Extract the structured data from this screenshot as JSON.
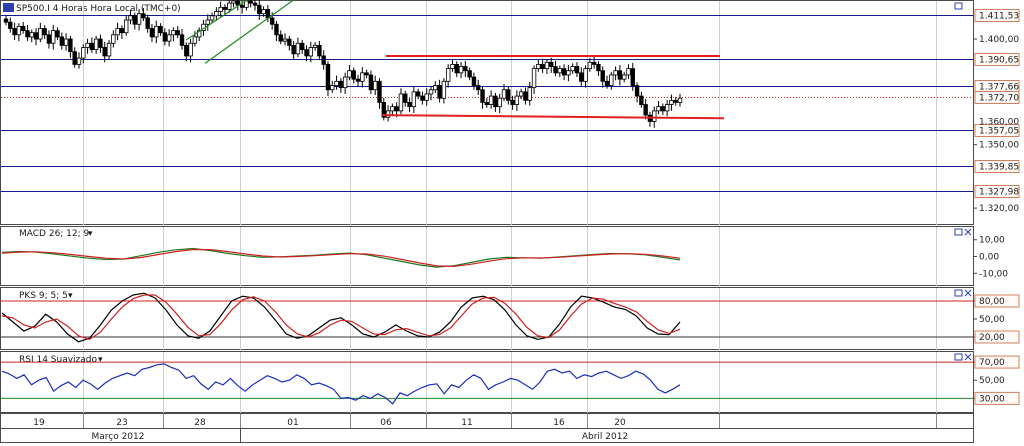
{
  "colors": {
    "background": "#ffffff",
    "pane_border": "#4a4a4a",
    "gridline": "#cfcfcf",
    "horizontal_level": "#1a1a8c",
    "red_level": "#e02020",
    "trend_line": "#1f8a1f",
    "candle": "#000000",
    "macd_line": "#1f7a1f",
    "signal_line": "#d02020",
    "stoch_k": "#000000",
    "stoch_d": "#d02020",
    "rsi_line": "#1a2fbf",
    "rsi_upper": "#d02020",
    "rsi_lower": "#1f8a1f",
    "badge_border": "#d08060",
    "badge_fill": "#fffaf5"
  },
  "header": {
    "symbol_icon": "instrument-icon",
    "title": "SP500.I 4 Horas Hora Local (TMC+0)"
  },
  "chart_data": [
    {
      "type": "candlestick",
      "pane": "price",
      "title": "SP500.I 4 Horas Hora Local (TMC+0)",
      "ylim": [
        1312,
        1418
      ],
      "y_ticks": [
        1400.0,
        1350.0,
        1320.0
      ],
      "y_tick_labels": [
        "1.400,00",
        "1.350,00",
        "1.320,00"
      ],
      "level_lines": [
        1411.53,
        1390.65,
        1377.66,
        1357.05,
        1339.85,
        1327.98
      ],
      "level_labels": [
        "1.411,53",
        "1.390,65",
        "1.377,66",
        "1.357,05",
        "1.339,85",
        "1.327,98"
      ],
      "last_price": 1372.7,
      "last_price_label": "1.372,70",
      "hidden_tick_label": "1.360,00",
      "red_resistance": {
        "from": 1392.0,
        "to": 1392.0
      },
      "red_support": {
        "from": 1364.0,
        "to": 1362.5
      },
      "green_trend": {
        "from": 1388.5,
        "to": 1419.0
      },
      "close": [
        1408,
        1405,
        1402,
        1406,
        1404,
        1401,
        1403,
        1400,
        1405,
        1402,
        1398,
        1404,
        1401,
        1397,
        1400,
        1394,
        1388,
        1391,
        1396,
        1398,
        1395,
        1400,
        1396,
        1392,
        1398,
        1402,
        1405,
        1403,
        1409,
        1411,
        1407,
        1412,
        1410,
        1405,
        1401,
        1406,
        1403,
        1399,
        1402,
        1404,
        1402,
        1397,
        1392,
        1398,
        1401,
        1404,
        1407,
        1409,
        1411,
        1413,
        1415,
        1414,
        1417,
        1418,
        1416,
        1415,
        1418,
        1417,
        1416,
        1412,
        1414,
        1410,
        1407,
        1402,
        1399,
        1400,
        1397,
        1393,
        1398,
        1395,
        1392,
        1396,
        1397,
        1392,
        1388,
        1376,
        1378,
        1380,
        1377,
        1382,
        1385,
        1381,
        1380,
        1384,
        1383,
        1376,
        1380,
        1370,
        1363,
        1366,
        1368,
        1366,
        1374,
        1370,
        1368,
        1375,
        1373,
        1371,
        1374,
        1376,
        1378,
        1372,
        1380,
        1386,
        1388,
        1384,
        1387,
        1385,
        1382,
        1378,
        1376,
        1370,
        1369,
        1373,
        1368,
        1372,
        1376,
        1371,
        1369,
        1373,
        1375,
        1371,
        1377,
        1386,
        1388,
        1386,
        1389,
        1387,
        1384,
        1386,
        1383,
        1385,
        1387,
        1384,
        1380,
        1386,
        1389,
        1388,
        1385,
        1380,
        1378,
        1383,
        1385,
        1381,
        1383,
        1386,
        1378,
        1373,
        1369,
        1364,
        1361,
        1366,
        1368,
        1366,
        1369,
        1371,
        1370,
        1372
      ],
      "x_tick_labels": [
        "19",
        "23",
        "28",
        "01",
        "06",
        "11",
        "16",
        "20"
      ],
      "month_labels": [
        "Março 2012",
        "Abril 2012"
      ]
    },
    {
      "type": "line",
      "pane": "macd",
      "title": "MACD 26; 12; 9",
      "ylim": [
        -17,
        17
      ],
      "y_ticks": [
        10,
        0,
        -10
      ],
      "y_tick_labels": [
        "10,00",
        "0,00",
        "-10,00"
      ],
      "series": [
        {
          "name": "MACD",
          "values": [
            2.5,
            3.0,
            2.6,
            1.5,
            0.2,
            -1.0,
            -1.8,
            -1.5,
            0.5,
            2.5,
            4.0,
            4.8,
            3.5,
            1.8,
            0.5,
            -0.5,
            -0.2,
            0.3,
            0.8,
            1.5,
            2.0,
            1.0,
            -1.0,
            -3.0,
            -5.0,
            -6.3,
            -5.5,
            -3.5,
            -1.5,
            -0.5,
            -0.8,
            -1.0,
            -0.3,
            0.5,
            1.2,
            1.8,
            1.6,
            1.0,
            -0.5,
            -2.0
          ]
        },
        {
          "name": "Sinal",
          "values": [
            2.0,
            2.6,
            2.8,
            2.2,
            1.2,
            0.0,
            -1.0,
            -1.5,
            -0.6,
            1.2,
            2.9,
            4.2,
            4.1,
            2.9,
            1.5,
            0.3,
            -0.3,
            0.0,
            0.5,
            1.1,
            1.7,
            1.5,
            0.2,
            -1.8,
            -3.8,
            -5.6,
            -5.9,
            -4.6,
            -2.8,
            -1.3,
            -0.8,
            -0.9,
            -0.5,
            0.2,
            0.9,
            1.5,
            1.7,
            1.3,
            0.3,
            -1.0
          ]
        }
      ]
    },
    {
      "type": "line",
      "pane": "stochastic",
      "title": "PKS 9; 5; 5",
      "ylim": [
        0,
        100
      ],
      "y_ticks": [
        80,
        50,
        20
      ],
      "y_tick_labels": [
        "80,00",
        "50,00",
        "20,00"
      ],
      "upper_level": 80,
      "lower_level": 20,
      "series": [
        {
          "name": "%K",
          "values": [
            60,
            45,
            30,
            38,
            58,
            45,
            25,
            12,
            18,
            40,
            65,
            80,
            90,
            93,
            85,
            65,
            40,
            22,
            18,
            30,
            55,
            80,
            88,
            85,
            70,
            48,
            25,
            18,
            22,
            35,
            48,
            52,
            40,
            25,
            20,
            28,
            40,
            30,
            22,
            20,
            28,
            45,
            70,
            85,
            88,
            82,
            65,
            40,
            22,
            16,
            20,
            42,
            70,
            88,
            85,
            78,
            70,
            66,
            55,
            35,
            25,
            24,
            45
          ]
        },
        {
          "name": "%D",
          "values": [
            55,
            52,
            40,
            35,
            45,
            50,
            38,
            22,
            16,
            28,
            50,
            70,
            84,
            90,
            90,
            78,
            58,
            36,
            22,
            24,
            42,
            65,
            82,
            87,
            80,
            62,
            40,
            25,
            20,
            27,
            40,
            48,
            46,
            35,
            25,
            24,
            32,
            34,
            28,
            22,
            24,
            35,
            55,
            75,
            85,
            86,
            76,
            58,
            36,
            22,
            19,
            32,
            55,
            75,
            85,
            83,
            76,
            70,
            62,
            46,
            32,
            26,
            33
          ]
        }
      ]
    },
    {
      "type": "line",
      "pane": "rsi",
      "title": "RSI 14 Suavizado",
      "ylim": [
        15,
        80
      ],
      "y_ticks": [
        70,
        50,
        30
      ],
      "y_tick_labels": [
        "70,00",
        "50,00",
        "30,00"
      ],
      "upper_level": 70,
      "lower_level": 30,
      "series": [
        {
          "name": "RSI",
          "values": [
            60,
            57,
            52,
            56,
            45,
            50,
            53,
            38,
            44,
            48,
            42,
            50,
            46,
            40,
            47,
            52,
            55,
            58,
            55,
            62,
            64,
            67,
            68,
            64,
            61,
            52,
            55,
            46,
            40,
            48,
            45,
            52,
            44,
            38,
            45,
            50,
            55,
            52,
            48,
            50,
            56,
            52,
            45,
            47,
            44,
            40,
            30,
            31,
            28,
            33,
            30,
            35,
            31,
            24,
            36,
            33,
            38,
            42,
            45,
            46,
            35,
            45,
            42,
            50,
            56,
            52,
            40,
            45,
            48,
            52,
            50,
            45,
            40,
            48,
            60,
            62,
            58,
            60,
            52,
            56,
            54,
            58,
            60,
            56,
            52,
            55,
            60,
            57,
            50,
            40,
            36,
            40,
            45
          ]
        }
      ]
    }
  ]
}
